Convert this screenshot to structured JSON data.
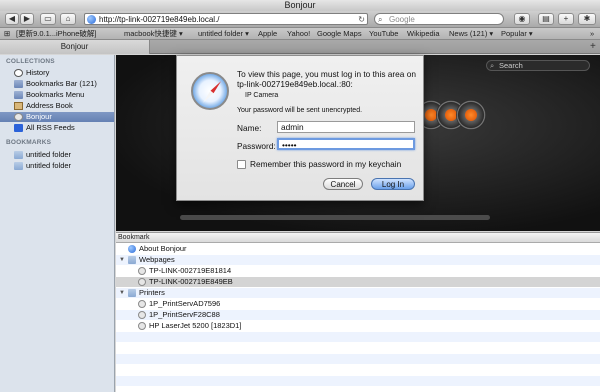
{
  "window": {
    "title": "Bonjour"
  },
  "toolbar": {
    "back_glyph": "◀",
    "forward_glyph": "▶",
    "sidebar_glyph": "▭",
    "home_glyph": "⌂",
    "add_glyph": "+",
    "url": "http://tp-link-002719e849eb.local./",
    "reload_glyph": "↻",
    "search_placeholder": "Google",
    "search_glyph": "⌕",
    "eye_glyph": "◉",
    "page_glyph": "▤",
    "new_glyph": "+",
    "settings_glyph": "✱"
  },
  "bookmarks_bar": {
    "toggle_glyph": "⊞",
    "items": [
      "[更新9.0.1...iPhone破解]",
      "macbook快捷键 ▾",
      "untitled folder ▾",
      "Apple",
      "Yahoo!",
      "Google Maps",
      "YouTube",
      "Wikipedia",
      "News (121) ▾",
      "Popular ▾"
    ],
    "overflow_glyph": "»"
  },
  "tabs": {
    "active": "Bonjour",
    "add_glyph": "+"
  },
  "sidebar": {
    "collections_header": "COLLECTIONS",
    "collections": [
      "History",
      "Bookmarks Bar (121)",
      "Bookmarks Menu",
      "Address Book",
      "Bonjour",
      "All RSS Feeds"
    ],
    "bookmarks_header": "BOOKMARKS",
    "bookmarks": [
      "untitled folder",
      "untitled folder"
    ]
  },
  "page": {
    "search_placeholder": "Search"
  },
  "bookmark_list": {
    "header": "Bookmark",
    "about": "About Bonjour",
    "webpages": "Webpages",
    "webpage_items": [
      "TP-LINK-002719E81814",
      "TP-LINK-002719E849EB"
    ],
    "printers": "Printers",
    "printer_items": [
      "1P_PrintServAD7596",
      "1P_PrintServF28C88",
      "HP LaserJet 5200 [1823D1]"
    ]
  },
  "dialog": {
    "message": "To view this page, you must log in to this area on tp-link-002719e849eb.local.:80:",
    "realm": "IP Camera",
    "warning": "Your password will be sent unencrypted.",
    "name_label": "Name:",
    "name_value": "admin",
    "password_label": "Password:",
    "password_value": "•••••",
    "remember_label": "Remember this password in my keychain",
    "cancel_label": "Cancel",
    "login_label": "Log In"
  }
}
